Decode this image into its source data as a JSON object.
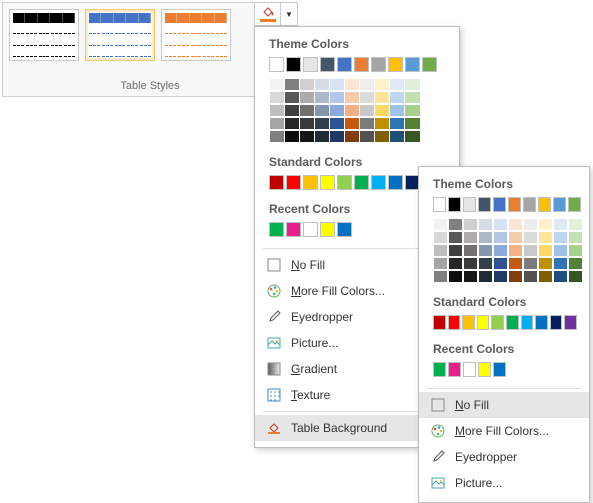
{
  "ribbon": {
    "label": "Table Styles"
  },
  "menu1": {
    "theme_h": "Theme Colors",
    "standard_h": "Standard Colors",
    "recent_h": "Recent Colors",
    "no_fill": "No Fill",
    "more_colors": "More Fill Colors...",
    "eyedropper": "Eyedropper",
    "picture": "Picture...",
    "gradient": "Gradient",
    "texture": "Texture",
    "table_bg": "Table Background"
  },
  "menu2": {
    "theme_h": "Theme Colors",
    "standard_h": "Standard Colors",
    "recent_h": "Recent Colors",
    "no_fill": "No Fill",
    "more_colors": "More Fill Colors...",
    "eyedropper": "Eyedropper",
    "picture": "Picture..."
  },
  "theme_row": [
    "#ffffff",
    "#000000",
    "#e7e6e6",
    "#44546a",
    "#4472c4",
    "#ed7d31",
    "#a5a5a5",
    "#ffc000",
    "#5b9bd5",
    "#70ad47"
  ],
  "theme_shades": [
    [
      "#f2f2f2",
      "#7f7f7f",
      "#d0cece",
      "#d6dce4",
      "#d9e2f3",
      "#fbe5d5",
      "#ededed",
      "#fff2cc",
      "#deebf6",
      "#e2efd9"
    ],
    [
      "#d8d8d8",
      "#595959",
      "#aeabab",
      "#adb9ca",
      "#b4c6e7",
      "#f7cbac",
      "#dbdbdb",
      "#fee599",
      "#bdd7ee",
      "#c5e0b3"
    ],
    [
      "#bfbfbf",
      "#3f3f3f",
      "#757070",
      "#8496b0",
      "#8eaadb",
      "#f4b183",
      "#c9c9c9",
      "#ffd965",
      "#9cc3e5",
      "#a8d08d"
    ],
    [
      "#a5a5a5",
      "#262626",
      "#3a3838",
      "#323f4f",
      "#2f5496",
      "#c55a11",
      "#7b7b7b",
      "#bf9000",
      "#2e75b5",
      "#538135"
    ],
    [
      "#7f7f7f",
      "#0c0c0c",
      "#171616",
      "#222a35",
      "#1f3864",
      "#833c0b",
      "#525252",
      "#7f6000",
      "#1e4e79",
      "#375623"
    ]
  ],
  "standard": [
    "#c00000",
    "#ff0000",
    "#ffc000",
    "#ffff00",
    "#92d050",
    "#00b050",
    "#00b0f0",
    "#0070c0",
    "#002060",
    "#7030a0"
  ],
  "recent": [
    "#00b050",
    "#e91e8c",
    "#ffffff",
    "#ffff00",
    "#0070c0"
  ]
}
